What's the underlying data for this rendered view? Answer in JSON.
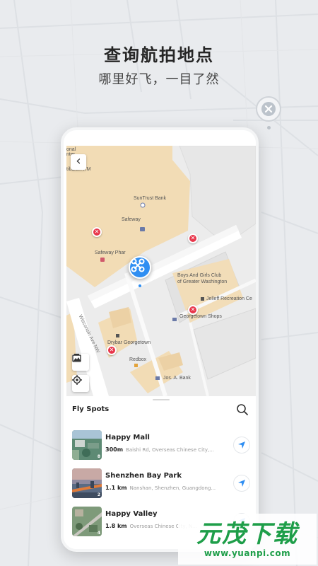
{
  "promo": {
    "headline": "查询航拍地点",
    "subline": "哪里好飞，一目了然"
  },
  "map": {
    "back_icon": "‹",
    "labels": {
      "top_cut": "onal\nnter",
      "citibank": "tibank ATM",
      "suntrust": "SunTrust Bank",
      "safeway": "Safeway",
      "safeway_pharmacy": "Safeway Phar",
      "boys_girls_1": "Boys And Girls Club",
      "boys_girls_2": "of Greater Washington",
      "jelleff": "Jelleff Recreation Ce",
      "georgetown_shops": "Georgetown Shops",
      "drybar": "Drybar Georgetown",
      "redbox": "Redbox",
      "jos_bank": "Jos. A. Bank",
      "street": "Wisconsin Ave NW"
    }
  },
  "panel": {
    "title": "Fly Spots",
    "spots": [
      {
        "name": "Happy Mall",
        "distance": "300m",
        "address": "Baishi Rd, Overseas Chinese City,...",
        "badge": "8"
      },
      {
        "name": "Shenzhen Bay Park",
        "distance": "1.1 km",
        "address": "Nanshan, Shenzhen, Guangdong...",
        "badge": "2"
      },
      {
        "name": "Happy Valley",
        "distance": "1.8 km",
        "address": "Overseas Chinese City, N...",
        "badge": "4"
      }
    ]
  },
  "watermark": {
    "logo": "元茂下载",
    "url": "www.yuanpi.com"
  },
  "colors": {
    "accent": "#2f8ef2",
    "no_fly": "#e8354a",
    "building": "#f2dcb5",
    "watermark": "#1e9e49"
  }
}
